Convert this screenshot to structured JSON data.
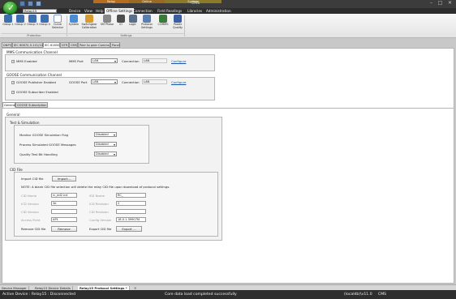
{
  "window": {
    "title": "CMS"
  },
  "context_tabs": [
    {
      "label": "Relay",
      "color": "#b66d1d"
    },
    {
      "label": "Online",
      "color": "#9a6a25"
    },
    {
      "label": "System",
      "color": "#8a7a2a"
    }
  ],
  "device_select": {
    "value": "Relay15"
  },
  "menu": [
    "Device",
    "View",
    "Help",
    "Offline Settings",
    "Connection",
    "Field Readings",
    "Libraries",
    "Administration"
  ],
  "ribbon": {
    "protection_buttons": [
      "Group 1",
      "Group 2",
      "Group 3",
      "Group 4",
      "Curve Selector"
    ],
    "settings_buttons": [
      "System",
      "Switchgear Calibration",
      "SM Phase",
      "IO",
      "Logic",
      "Protocol Settings",
      "COMMS",
      "Power Quality"
    ],
    "groups": [
      "Protection",
      "Settings"
    ]
  },
  "protocol_tabs": [
    "DNP3",
    "IEC 60870-5-101/104",
    "IEC 61850",
    "DTR",
    "CMS",
    "Peer to peer Comms",
    "Panel"
  ],
  "mms": {
    "legend": "MMS Communication Channel",
    "enabled_label": "MMS Enabled",
    "port_label": "MMS Port",
    "port_value": "LAN",
    "connection_label": "Connection",
    "connection_value": "LAN",
    "configure": "Configure"
  },
  "goose": {
    "legend": "GOOSE Communication Channel",
    "publisher_label": "GOOSE Publisher Enabled",
    "port_label": "GOOSE Port",
    "port_value": "LAN",
    "connection_label": "Connection",
    "connection_value": "LAN",
    "configure": "Configure",
    "subscriber_label": "GOOSE Subscriber Enabled"
  },
  "sub_tabs": [
    "General",
    "GOOSE Subscription"
  ],
  "general": {
    "legend": "General",
    "test_legend": "Test & Simulation",
    "rows": [
      {
        "label": "Monitor GOOSE Simulation Flag",
        "value": "Disabled"
      },
      {
        "label": "Process Simulated GOOSE Messages",
        "value": "Disabled"
      },
      {
        "label": "Quality Test Bit Handling",
        "value": "Disabled"
      }
    ],
    "cid_legend": "CID File",
    "import_label": "Import CID file",
    "import_button": "Import...",
    "note": "NOTE: A blank CID file selection will delete the relay CID file upon download of protocol settings.",
    "left_fields": [
      {
        "label": "CID Name",
        "value": "rc_ed2.icd"
      },
      {
        "label": "ICD Version",
        "value": "3e"
      },
      {
        "label": "CID Version",
        "value": ""
      },
      {
        "label": "Access Point",
        "value": "AP1"
      }
    ],
    "right_fields": [
      {
        "label": "IED Name",
        "value": "RC_"
      },
      {
        "label": "ICD Revision",
        "value": "2"
      },
      {
        "label": "CID Revision",
        "value": ""
      },
      {
        "label": "Config Version",
        "value": "18.0.1.39907M"
      }
    ],
    "remove_label": "Remove CID file",
    "remove_button": "Remove",
    "export_label": "Export CID file",
    "export_button": "Export ..."
  },
  "bottom_tabs": [
    "Device Manager",
    "Relay15 Device Details",
    "Relay15 Protocol Settings *"
  ],
  "status": {
    "left": "Active Device : Relay15 : Disconnected",
    "center": "Core data load completed successfully",
    "right": "(localdb)\\v11.0",
    "app": "CMS"
  }
}
